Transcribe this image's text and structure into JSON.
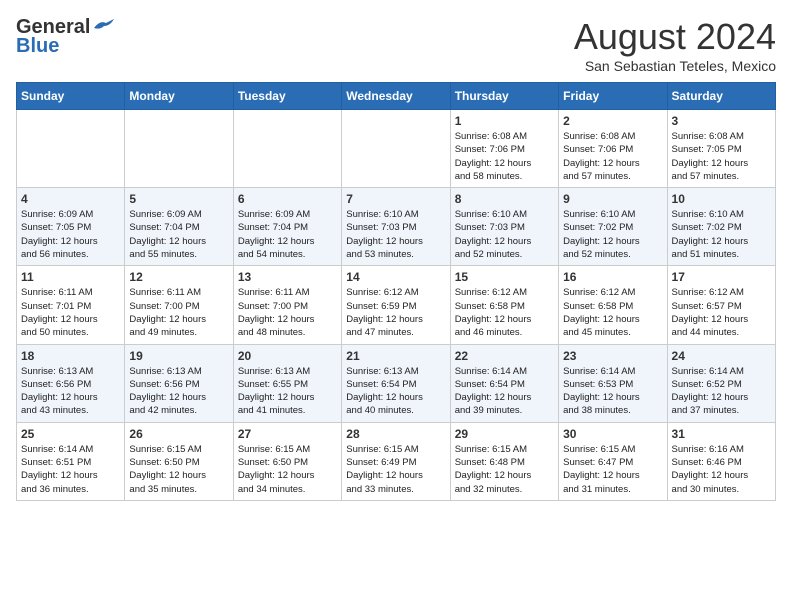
{
  "header": {
    "logo_general": "General",
    "logo_blue": "Blue",
    "month_year": "August 2024",
    "location": "San Sebastian Teteles, Mexico"
  },
  "days_of_week": [
    "Sunday",
    "Monday",
    "Tuesday",
    "Wednesday",
    "Thursday",
    "Friday",
    "Saturday"
  ],
  "weeks": [
    [
      {
        "day": "",
        "info": ""
      },
      {
        "day": "",
        "info": ""
      },
      {
        "day": "",
        "info": ""
      },
      {
        "day": "",
        "info": ""
      },
      {
        "day": "1",
        "info": "Sunrise: 6:08 AM\nSunset: 7:06 PM\nDaylight: 12 hours\nand 58 minutes."
      },
      {
        "day": "2",
        "info": "Sunrise: 6:08 AM\nSunset: 7:06 PM\nDaylight: 12 hours\nand 57 minutes."
      },
      {
        "day": "3",
        "info": "Sunrise: 6:08 AM\nSunset: 7:05 PM\nDaylight: 12 hours\nand 57 minutes."
      }
    ],
    [
      {
        "day": "4",
        "info": "Sunrise: 6:09 AM\nSunset: 7:05 PM\nDaylight: 12 hours\nand 56 minutes."
      },
      {
        "day": "5",
        "info": "Sunrise: 6:09 AM\nSunset: 7:04 PM\nDaylight: 12 hours\nand 55 minutes."
      },
      {
        "day": "6",
        "info": "Sunrise: 6:09 AM\nSunset: 7:04 PM\nDaylight: 12 hours\nand 54 minutes."
      },
      {
        "day": "7",
        "info": "Sunrise: 6:10 AM\nSunset: 7:03 PM\nDaylight: 12 hours\nand 53 minutes."
      },
      {
        "day": "8",
        "info": "Sunrise: 6:10 AM\nSunset: 7:03 PM\nDaylight: 12 hours\nand 52 minutes."
      },
      {
        "day": "9",
        "info": "Sunrise: 6:10 AM\nSunset: 7:02 PM\nDaylight: 12 hours\nand 52 minutes."
      },
      {
        "day": "10",
        "info": "Sunrise: 6:10 AM\nSunset: 7:02 PM\nDaylight: 12 hours\nand 51 minutes."
      }
    ],
    [
      {
        "day": "11",
        "info": "Sunrise: 6:11 AM\nSunset: 7:01 PM\nDaylight: 12 hours\nand 50 minutes."
      },
      {
        "day": "12",
        "info": "Sunrise: 6:11 AM\nSunset: 7:00 PM\nDaylight: 12 hours\nand 49 minutes."
      },
      {
        "day": "13",
        "info": "Sunrise: 6:11 AM\nSunset: 7:00 PM\nDaylight: 12 hours\nand 48 minutes."
      },
      {
        "day": "14",
        "info": "Sunrise: 6:12 AM\nSunset: 6:59 PM\nDaylight: 12 hours\nand 47 minutes."
      },
      {
        "day": "15",
        "info": "Sunrise: 6:12 AM\nSunset: 6:58 PM\nDaylight: 12 hours\nand 46 minutes."
      },
      {
        "day": "16",
        "info": "Sunrise: 6:12 AM\nSunset: 6:58 PM\nDaylight: 12 hours\nand 45 minutes."
      },
      {
        "day": "17",
        "info": "Sunrise: 6:12 AM\nSunset: 6:57 PM\nDaylight: 12 hours\nand 44 minutes."
      }
    ],
    [
      {
        "day": "18",
        "info": "Sunrise: 6:13 AM\nSunset: 6:56 PM\nDaylight: 12 hours\nand 43 minutes."
      },
      {
        "day": "19",
        "info": "Sunrise: 6:13 AM\nSunset: 6:56 PM\nDaylight: 12 hours\nand 42 minutes."
      },
      {
        "day": "20",
        "info": "Sunrise: 6:13 AM\nSunset: 6:55 PM\nDaylight: 12 hours\nand 41 minutes."
      },
      {
        "day": "21",
        "info": "Sunrise: 6:13 AM\nSunset: 6:54 PM\nDaylight: 12 hours\nand 40 minutes."
      },
      {
        "day": "22",
        "info": "Sunrise: 6:14 AM\nSunset: 6:54 PM\nDaylight: 12 hours\nand 39 minutes."
      },
      {
        "day": "23",
        "info": "Sunrise: 6:14 AM\nSunset: 6:53 PM\nDaylight: 12 hours\nand 38 minutes."
      },
      {
        "day": "24",
        "info": "Sunrise: 6:14 AM\nSunset: 6:52 PM\nDaylight: 12 hours\nand 37 minutes."
      }
    ],
    [
      {
        "day": "25",
        "info": "Sunrise: 6:14 AM\nSunset: 6:51 PM\nDaylight: 12 hours\nand 36 minutes."
      },
      {
        "day": "26",
        "info": "Sunrise: 6:15 AM\nSunset: 6:50 PM\nDaylight: 12 hours\nand 35 minutes."
      },
      {
        "day": "27",
        "info": "Sunrise: 6:15 AM\nSunset: 6:50 PM\nDaylight: 12 hours\nand 34 minutes."
      },
      {
        "day": "28",
        "info": "Sunrise: 6:15 AM\nSunset: 6:49 PM\nDaylight: 12 hours\nand 33 minutes."
      },
      {
        "day": "29",
        "info": "Sunrise: 6:15 AM\nSunset: 6:48 PM\nDaylight: 12 hours\nand 32 minutes."
      },
      {
        "day": "30",
        "info": "Sunrise: 6:15 AM\nSunset: 6:47 PM\nDaylight: 12 hours\nand 31 minutes."
      },
      {
        "day": "31",
        "info": "Sunrise: 6:16 AM\nSunset: 6:46 PM\nDaylight: 12 hours\nand 30 minutes."
      }
    ]
  ]
}
